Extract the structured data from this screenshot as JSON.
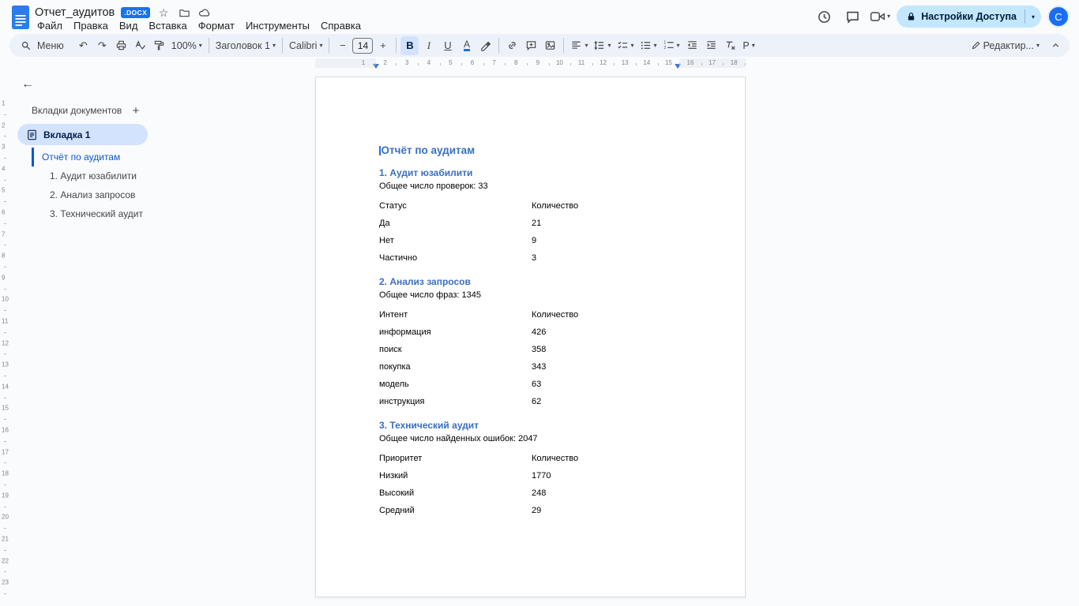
{
  "header": {
    "doc_title": "Отчет_аудитов",
    "file_badge": ".DOCX",
    "menus": [
      "Файл",
      "Правка",
      "Вид",
      "Вставка",
      "Формат",
      "Инструменты",
      "Справка"
    ],
    "share_button": "Настройки Доступа",
    "avatar_letter": "C"
  },
  "toolbar": {
    "menu_label": "Меню",
    "zoom_value": "100%",
    "style_value": "Заголовок 1",
    "font_value": "Calibri",
    "font_size_value": "14",
    "bold_label": "B",
    "italic_label": "I",
    "underline_label": "U",
    "text_color_label": "A",
    "input_tools_label": "Р",
    "mode_value": "Редактир..."
  },
  "tabs_panel": {
    "title": "Вкладки документов",
    "tab_name": "Вкладка 1",
    "outline": [
      {
        "label": "Отчёт по аудитам"
      },
      {
        "label": "1. Аудит юзабилити"
      },
      {
        "label": "2. Анализ запросов"
      },
      {
        "label": "3. Технический аудит"
      }
    ]
  },
  "ruler": {
    "h_numbers": [
      "1",
      "2",
      "3",
      "4",
      "5",
      "6",
      "7",
      "8",
      "9",
      "10",
      "11",
      "12",
      "13",
      "14",
      "15",
      "16",
      "17",
      "18"
    ],
    "v_numbers": [
      "1",
      "2",
      "3",
      "4",
      "5",
      "6",
      "7",
      "8",
      "9",
      "10",
      "11",
      "12",
      "13",
      "14",
      "15",
      "16",
      "17",
      "18",
      "19",
      "20",
      "21",
      "22",
      "23"
    ]
  },
  "document": {
    "title": "Отчёт по аудитам",
    "sections": [
      {
        "heading": "1. Аудит юзабилити",
        "summary": "Общее число проверок: 33",
        "table": {
          "col1": "Статус",
          "col2": "Количество",
          "rows": [
            [
              "Да",
              "21"
            ],
            [
              "Нет",
              "9"
            ],
            [
              "Частично",
              "3"
            ]
          ]
        }
      },
      {
        "heading": "2. Анализ запросов",
        "summary": "Общее число фраз: 1345",
        "table": {
          "col1": "Интент",
          "col2": "Количество",
          "rows": [
            [
              "информация",
              "426"
            ],
            [
              "поиск",
              "358"
            ],
            [
              "покупка",
              "343"
            ],
            [
              "модель",
              "63"
            ],
            [
              "инструкция",
              "62"
            ]
          ]
        }
      },
      {
        "heading": "3. Технический аудит",
        "summary": "Общее число найденных ошибок: 2047",
        "table": {
          "col1": "Приоритет",
          "col2": "Количество",
          "rows": [
            [
              "Низкий",
              "1770"
            ],
            [
              "Высокий",
              "248"
            ],
            [
              "Средний",
              "29"
            ]
          ]
        }
      }
    ]
  },
  "colors": {
    "accent_blue": "#0b57d0",
    "heading_blue": "#3a6fc0",
    "share_pill_bg": "#c2e7ff",
    "toolbar_bg": "#edf2fa",
    "tab_pill_bg": "#d3e3fd",
    "badge_bg": "#1a73e8"
  }
}
